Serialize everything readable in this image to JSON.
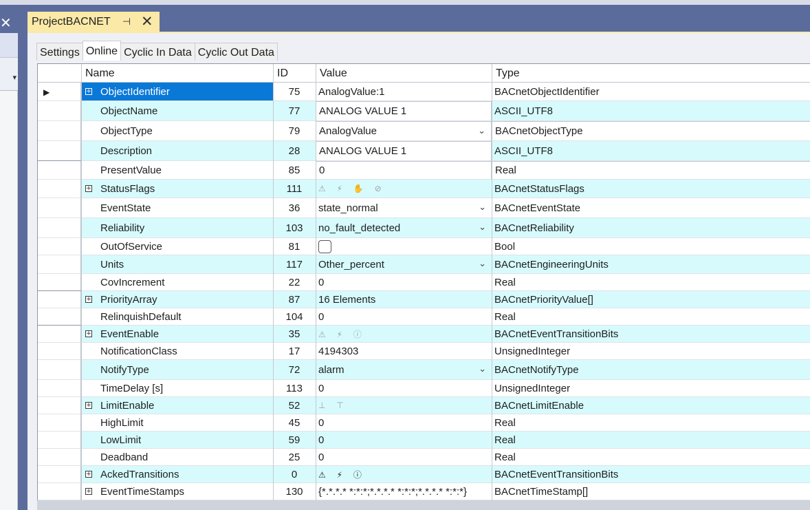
{
  "window": {
    "tab_title": "ProjectBACNET",
    "pin_icon": "pin-icon",
    "close_icon": "close-icon"
  },
  "subtabs": [
    "Settings",
    "Online",
    "Cyclic In Data",
    "Cyclic Out Data"
  ],
  "active_subtab": "Online",
  "columns": {
    "name": "Name",
    "id": "ID",
    "value": "Value",
    "type": "Type"
  },
  "rows": [
    {
      "name": "ObjectIdentifier",
      "id": "75",
      "value": "AnalogValue:1",
      "type": "BACnetObjectIdentifier",
      "expand": true
    },
    {
      "name": "ObjectName",
      "id": "77",
      "value": "ANALOG VALUE 1",
      "type": "ASCII_UTF8"
    },
    {
      "name": "ObjectType",
      "id": "79",
      "value": "AnalogValue",
      "type": "BACnetObjectType",
      "dropdown": true
    },
    {
      "name": "Description",
      "id": "28",
      "value": "ANALOG VALUE 1",
      "type": "ASCII_UTF8"
    },
    {
      "name": "PresentValue",
      "id": "85",
      "value": "0",
      "type": "Real"
    },
    {
      "name": "StatusFlags",
      "id": "111",
      "value": "",
      "flags": "⚠ ⚡ ✋ ⊘",
      "type": "BACnetStatusFlags",
      "expand": true
    },
    {
      "name": "EventState",
      "id": "36",
      "value": "state_normal",
      "type": "BACnetEventState",
      "dropdown": true
    },
    {
      "name": "Reliability",
      "id": "103",
      "value": "no_fault_detected",
      "type": "BACnetReliability",
      "dropdown": true
    },
    {
      "name": "OutOfService",
      "id": "81",
      "value": "",
      "checkbox": true,
      "type": "Bool"
    },
    {
      "name": "Units",
      "id": "117",
      "value": "Other_percent",
      "type": "BACnetEngineeringUnits",
      "dropdown": true
    },
    {
      "name": "CovIncrement",
      "id": "22",
      "value": "0",
      "type": "Real"
    },
    {
      "name": "PriorityArray",
      "id": "87",
      "value": "16 Elements",
      "type": "BACnetPriorityValue[]",
      "expand": true
    },
    {
      "name": "RelinquishDefault",
      "id": "104",
      "value": "0",
      "type": "Real"
    },
    {
      "name": "EventEnable",
      "id": "35",
      "value": "",
      "flags": "⚠ ⚡ ⓘ",
      "type": "BACnetEventTransitionBits",
      "expand": true
    },
    {
      "name": "NotificationClass",
      "id": "17",
      "value": "4194303",
      "type": "UnsignedInteger"
    },
    {
      "name": "NotifyType",
      "id": "72",
      "value": "alarm",
      "type": "BACnetNotifyType",
      "dropdown": true
    },
    {
      "name": "TimeDelay [s]",
      "id": "113",
      "value": "0",
      "type": "UnsignedInteger"
    },
    {
      "name": "LimitEnable",
      "id": "52",
      "value": "",
      "flags": "⊥ ⊤",
      "type": "BACnetLimitEnable",
      "expand": true
    },
    {
      "name": "HighLimit",
      "id": "45",
      "value": "0",
      "type": "Real"
    },
    {
      "name": "LowLimit",
      "id": "59",
      "value": "0",
      "type": "Real"
    },
    {
      "name": "Deadband",
      "id": "25",
      "value": "0",
      "type": "Real"
    },
    {
      "name": "AckedTransitions",
      "id": "0",
      "value": "",
      "flags": "⚠ ⚡ ⓘ",
      "flags_dark": true,
      "type": "BACnetEventTransitionBits",
      "expand": true
    },
    {
      "name": "EventTimeStamps",
      "id": "130",
      "value": "{*.*.*.* *:*:*;*.*.*.* *:*:*;*.*.*.* *:*:*}",
      "type": "BACnetTimeStamp[]",
      "expand": true
    }
  ]
}
